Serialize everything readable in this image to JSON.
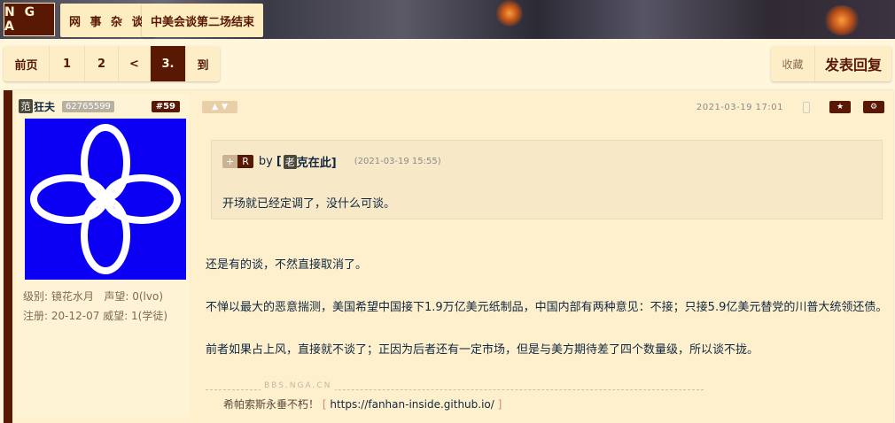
{
  "header": {
    "logo": "N G A",
    "breadcrumbs": [
      "网 事 杂 谈",
      "中美会谈第二场结束"
    ]
  },
  "pager": {
    "items": [
      {
        "label": "前页",
        "active": false
      },
      {
        "label": "1",
        "active": false
      },
      {
        "label": "2",
        "active": false
      },
      {
        "label": "<",
        "active": false
      },
      {
        "label": "3.",
        "active": true
      },
      {
        "label": "到",
        "active": false
      }
    ]
  },
  "actions": {
    "favorite": "收藏",
    "reply": "发表回复"
  },
  "post": {
    "author": {
      "badge": "范",
      "name": "狂夫",
      "uid": "62765599",
      "floor": "#59",
      "level_label": "级别:",
      "level": "镜花水月",
      "rep_label": "声望:",
      "rep": "0(lvo)",
      "reg_label": "注册:",
      "reg": "20-12-07",
      "prestige_label": "威望:",
      "prestige": "1(学徒)"
    },
    "time": "2021-03-19 17:01",
    "quote": {
      "plus": "+",
      "r": "R",
      "by": "by",
      "open_bracket": "[",
      "author_badge": "老",
      "author": "克在此]",
      "time": "(2021-03-19 15:55)",
      "text": "开场就已经定调了，没什么可谈。"
    },
    "paragraphs": [
      "还是有的谈，不然直接取消了。",
      "不惮以最大的恶意揣测，美国希望中国接下1.9万亿美元纸制品，中国内部有两种意见：不接；只接5.9亿美元替党的川普大统领还债。",
      "前者如果占上风，直接就不谈了；正因为后者还有一定市场，但是与美方期待差了四个数量级，所以谈不拢。"
    ],
    "watermark": "BBS.NGA.CN",
    "signature": {
      "text": "希帕索斯永垂不朽！",
      "open": "[",
      "link": "https://fanhan-inside.github.io/",
      "close": "]"
    }
  },
  "colors": {
    "brand": "#591804",
    "background": "#fff6dc",
    "avatar_bg": "#0b00f4"
  }
}
